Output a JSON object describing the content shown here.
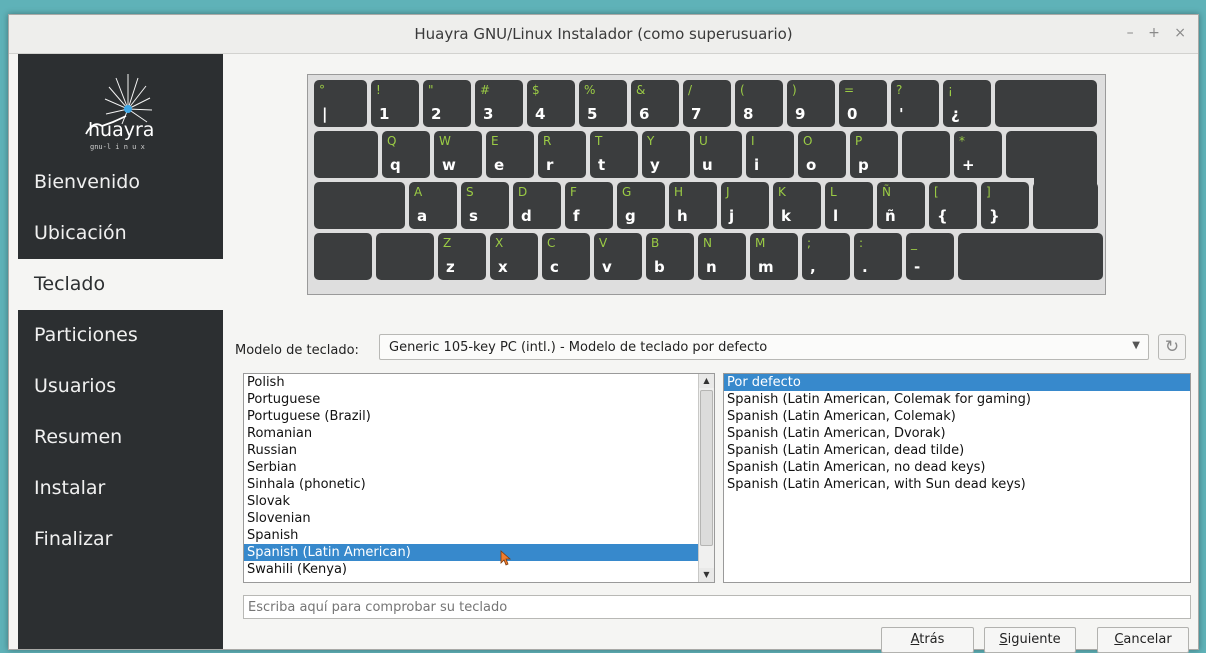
{
  "window": {
    "title": "Huayra GNU/Linux Instalador (como superusuario)"
  },
  "titlebar_controls": [
    "–",
    "+",
    "×"
  ],
  "logo": {
    "name": "huayra",
    "tagline": "gnu-l i n u x"
  },
  "sidebar": {
    "items": [
      {
        "label": "Bienvenido",
        "active": false
      },
      {
        "label": "Ubicación",
        "active": false
      },
      {
        "label": "Teclado",
        "active": true
      },
      {
        "label": "Particiones",
        "active": false
      },
      {
        "label": "Usuarios",
        "active": false
      },
      {
        "label": "Resumen",
        "active": false
      },
      {
        "label": "Instalar",
        "active": false
      },
      {
        "label": "Finalizar",
        "active": false
      }
    ]
  },
  "keyboard": {
    "colors": {
      "key": "#3b3d3e",
      "shift_label": "#9bcc45",
      "base_label": "#ffffff"
    },
    "rows": [
      [
        {
          "s": "°",
          "b": "|"
        },
        {
          "s": "!",
          "b": "1"
        },
        {
          "s": "\"",
          "b": "2"
        },
        {
          "s": "#",
          "b": "3"
        },
        {
          "s": "$",
          "b": "4"
        },
        {
          "s": "%",
          "b": "5"
        },
        {
          "s": "&",
          "b": "6"
        },
        {
          "s": "/",
          "b": "7"
        },
        {
          "s": "(",
          "b": "8"
        },
        {
          "s": ")",
          "b": "9"
        },
        {
          "s": "=",
          "b": "0"
        },
        {
          "s": "?",
          "b": "'"
        },
        {
          "s": "¡",
          "b": "¿"
        },
        {
          "s": "",
          "b": ""
        }
      ],
      [
        {
          "s": "",
          "b": ""
        },
        {
          "s": "Q",
          "b": "q"
        },
        {
          "s": "W",
          "b": "w"
        },
        {
          "s": "E",
          "b": "e"
        },
        {
          "s": "R",
          "b": "r"
        },
        {
          "s": "T",
          "b": "t"
        },
        {
          "s": "Y",
          "b": "y"
        },
        {
          "s": "U",
          "b": "u"
        },
        {
          "s": "I",
          "b": "i"
        },
        {
          "s": "O",
          "b": "o"
        },
        {
          "s": "P",
          "b": "p"
        },
        {
          "s": "",
          "b": ""
        },
        {
          "s": "*",
          "b": "+"
        },
        {
          "s": "",
          "b": ""
        }
      ],
      [
        {
          "s": "",
          "b": ""
        },
        {
          "s": "A",
          "b": "a"
        },
        {
          "s": "S",
          "b": "s"
        },
        {
          "s": "D",
          "b": "d"
        },
        {
          "s": "F",
          "b": "f"
        },
        {
          "s": "G",
          "b": "g"
        },
        {
          "s": "H",
          "b": "h"
        },
        {
          "s": "J",
          "b": "j"
        },
        {
          "s": "K",
          "b": "k"
        },
        {
          "s": "L",
          "b": "l"
        },
        {
          "s": "Ñ",
          "b": "ñ"
        },
        {
          "s": "[",
          "b": "{"
        },
        {
          "s": "]",
          "b": "}"
        },
        {
          "s": "",
          "b": ""
        }
      ],
      [
        {
          "s": "",
          "b": ""
        },
        {
          "s": "",
          "b": ""
        },
        {
          "s": "Z",
          "b": "z"
        },
        {
          "s": "X",
          "b": "x"
        },
        {
          "s": "C",
          "b": "c"
        },
        {
          "s": "V",
          "b": "v"
        },
        {
          "s": "B",
          "b": "b"
        },
        {
          "s": "N",
          "b": "n"
        },
        {
          "s": "M",
          "b": "m"
        },
        {
          "s": ";",
          "b": ","
        },
        {
          "s": ":",
          "b": "."
        },
        {
          "s": "_",
          "b": "-"
        },
        {
          "s": "",
          "b": ""
        }
      ]
    ]
  },
  "model": {
    "label": "Modelo de teclado:",
    "value": "Generic 105-key PC (intl.)  -  Modelo de teclado por defecto"
  },
  "layouts": {
    "items": [
      "Polish",
      "Portuguese",
      "Portuguese (Brazil)",
      "Romanian",
      "Russian",
      "Serbian",
      "Sinhala (phonetic)",
      "Slovak",
      "Slovenian",
      "Spanish",
      "Spanish (Latin American)",
      "Swahili (Kenya)"
    ],
    "selected_index": 10
  },
  "variants": {
    "items": [
      "Por defecto",
      "Spanish (Latin American, Colemak for gaming)",
      "Spanish (Latin American, Colemak)",
      "Spanish (Latin American, Dvorak)",
      "Spanish (Latin American, dead tilde)",
      "Spanish (Latin American, no dead keys)",
      "Spanish (Latin American, with Sun dead keys)"
    ],
    "selected_index": 0
  },
  "test_input": {
    "placeholder": "Escriba aquí para comprobar su teclado",
    "value": ""
  },
  "buttons": {
    "back": {
      "mnemonic": "A",
      "rest": "trás"
    },
    "next": {
      "mnemonic": "S",
      "rest": "iguiente"
    },
    "cancel": {
      "mnemonic": "C",
      "rest": "ancelar"
    }
  }
}
